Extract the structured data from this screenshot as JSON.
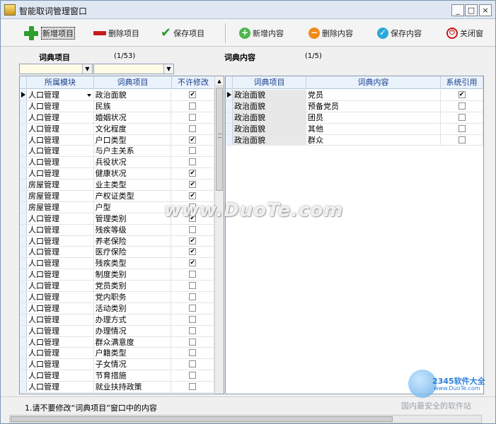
{
  "window": {
    "title": "智能取词管理窗口",
    "controls": {
      "minimize": "_",
      "maximize": "□",
      "close": "×"
    }
  },
  "toolbar": {
    "buttons": [
      {
        "label": "新增项目",
        "icon": "plus-icon"
      },
      {
        "label": "删除项目",
        "icon": "minus-icon"
      },
      {
        "label": "保存项目",
        "icon": "check-icon"
      },
      {
        "label": "新增内容",
        "icon": "add-circle-icon"
      },
      {
        "label": "删除内容",
        "icon": "remove-circle-icon"
      },
      {
        "label": "保存内容",
        "icon": "save-circle-icon"
      },
      {
        "label": "关闭窗",
        "icon": "power-icon"
      }
    ]
  },
  "left": {
    "section_label": "词典项目",
    "counter": "(1/53)",
    "columns": [
      "所属模块",
      "词典项目",
      "不许修改"
    ],
    "rows": [
      {
        "module": "人口管理",
        "item": "政治面貌",
        "locked": true
      },
      {
        "module": "人口管理",
        "item": "民族",
        "locked": false
      },
      {
        "module": "人口管理",
        "item": "婚姻状况",
        "locked": false
      },
      {
        "module": "人口管理",
        "item": "文化程度",
        "locked": false
      },
      {
        "module": "人口管理",
        "item": "户口类型",
        "locked": true
      },
      {
        "module": "人口管理",
        "item": "与户主关系",
        "locked": false
      },
      {
        "module": "人口管理",
        "item": "兵役状况",
        "locked": false
      },
      {
        "module": "人口管理",
        "item": "健康状况",
        "locked": true
      },
      {
        "module": "房屋管理",
        "item": "业主类型",
        "locked": true
      },
      {
        "module": "房屋管理",
        "item": "产权证类型",
        "locked": true
      },
      {
        "module": "房屋管理",
        "item": "户型",
        "locked": false
      },
      {
        "module": "人口管理",
        "item": "管理类别",
        "locked": true
      },
      {
        "module": "人口管理",
        "item": "残疾等级",
        "locked": false
      },
      {
        "module": "人口管理",
        "item": "养老保险",
        "locked": true
      },
      {
        "module": "人口管理",
        "item": "医疗保险",
        "locked": true
      },
      {
        "module": "人口管理",
        "item": "残疾类型",
        "locked": true
      },
      {
        "module": "人口管理",
        "item": "制度类别",
        "locked": false
      },
      {
        "module": "人口管理",
        "item": "党员类别",
        "locked": false
      },
      {
        "module": "人口管理",
        "item": "党内职务",
        "locked": false
      },
      {
        "module": "人口管理",
        "item": "活动类别",
        "locked": false
      },
      {
        "module": "人口管理",
        "item": "办理方式",
        "locked": false
      },
      {
        "module": "人口管理",
        "item": "办理情况",
        "locked": false
      },
      {
        "module": "人口管理",
        "item": "群众满意度",
        "locked": false
      },
      {
        "module": "人口管理",
        "item": "户籍类型",
        "locked": false
      },
      {
        "module": "人口管理",
        "item": "子女情况",
        "locked": false
      },
      {
        "module": "人口管理",
        "item": "节育措施",
        "locked": false
      },
      {
        "module": "人口管理",
        "item": "就业扶持政策",
        "locked": false
      }
    ]
  },
  "right": {
    "section_label": "词典内容",
    "counter": "(1/5)",
    "columns": [
      "词典项目",
      "词典内容",
      "系统引用"
    ],
    "rows": [
      {
        "item": "政治面貌",
        "content": "党员",
        "system": true
      },
      {
        "item": "政治面貌",
        "content": "预备党员",
        "system": false
      },
      {
        "item": "政治面貌",
        "content": "团员",
        "system": false
      },
      {
        "item": "政治面貌",
        "content": "其他",
        "system": false
      },
      {
        "item": "政治面貌",
        "content": "群众",
        "system": false
      }
    ]
  },
  "status": {
    "note": "1.请不要修改“词典项目”窗口中的内容"
  },
  "watermark": {
    "text": "www.DuoTe.com",
    "brand": "2345软件大全",
    "brand_url": "www.DuoTe.com",
    "slogan": "国内最安全的软件站"
  }
}
